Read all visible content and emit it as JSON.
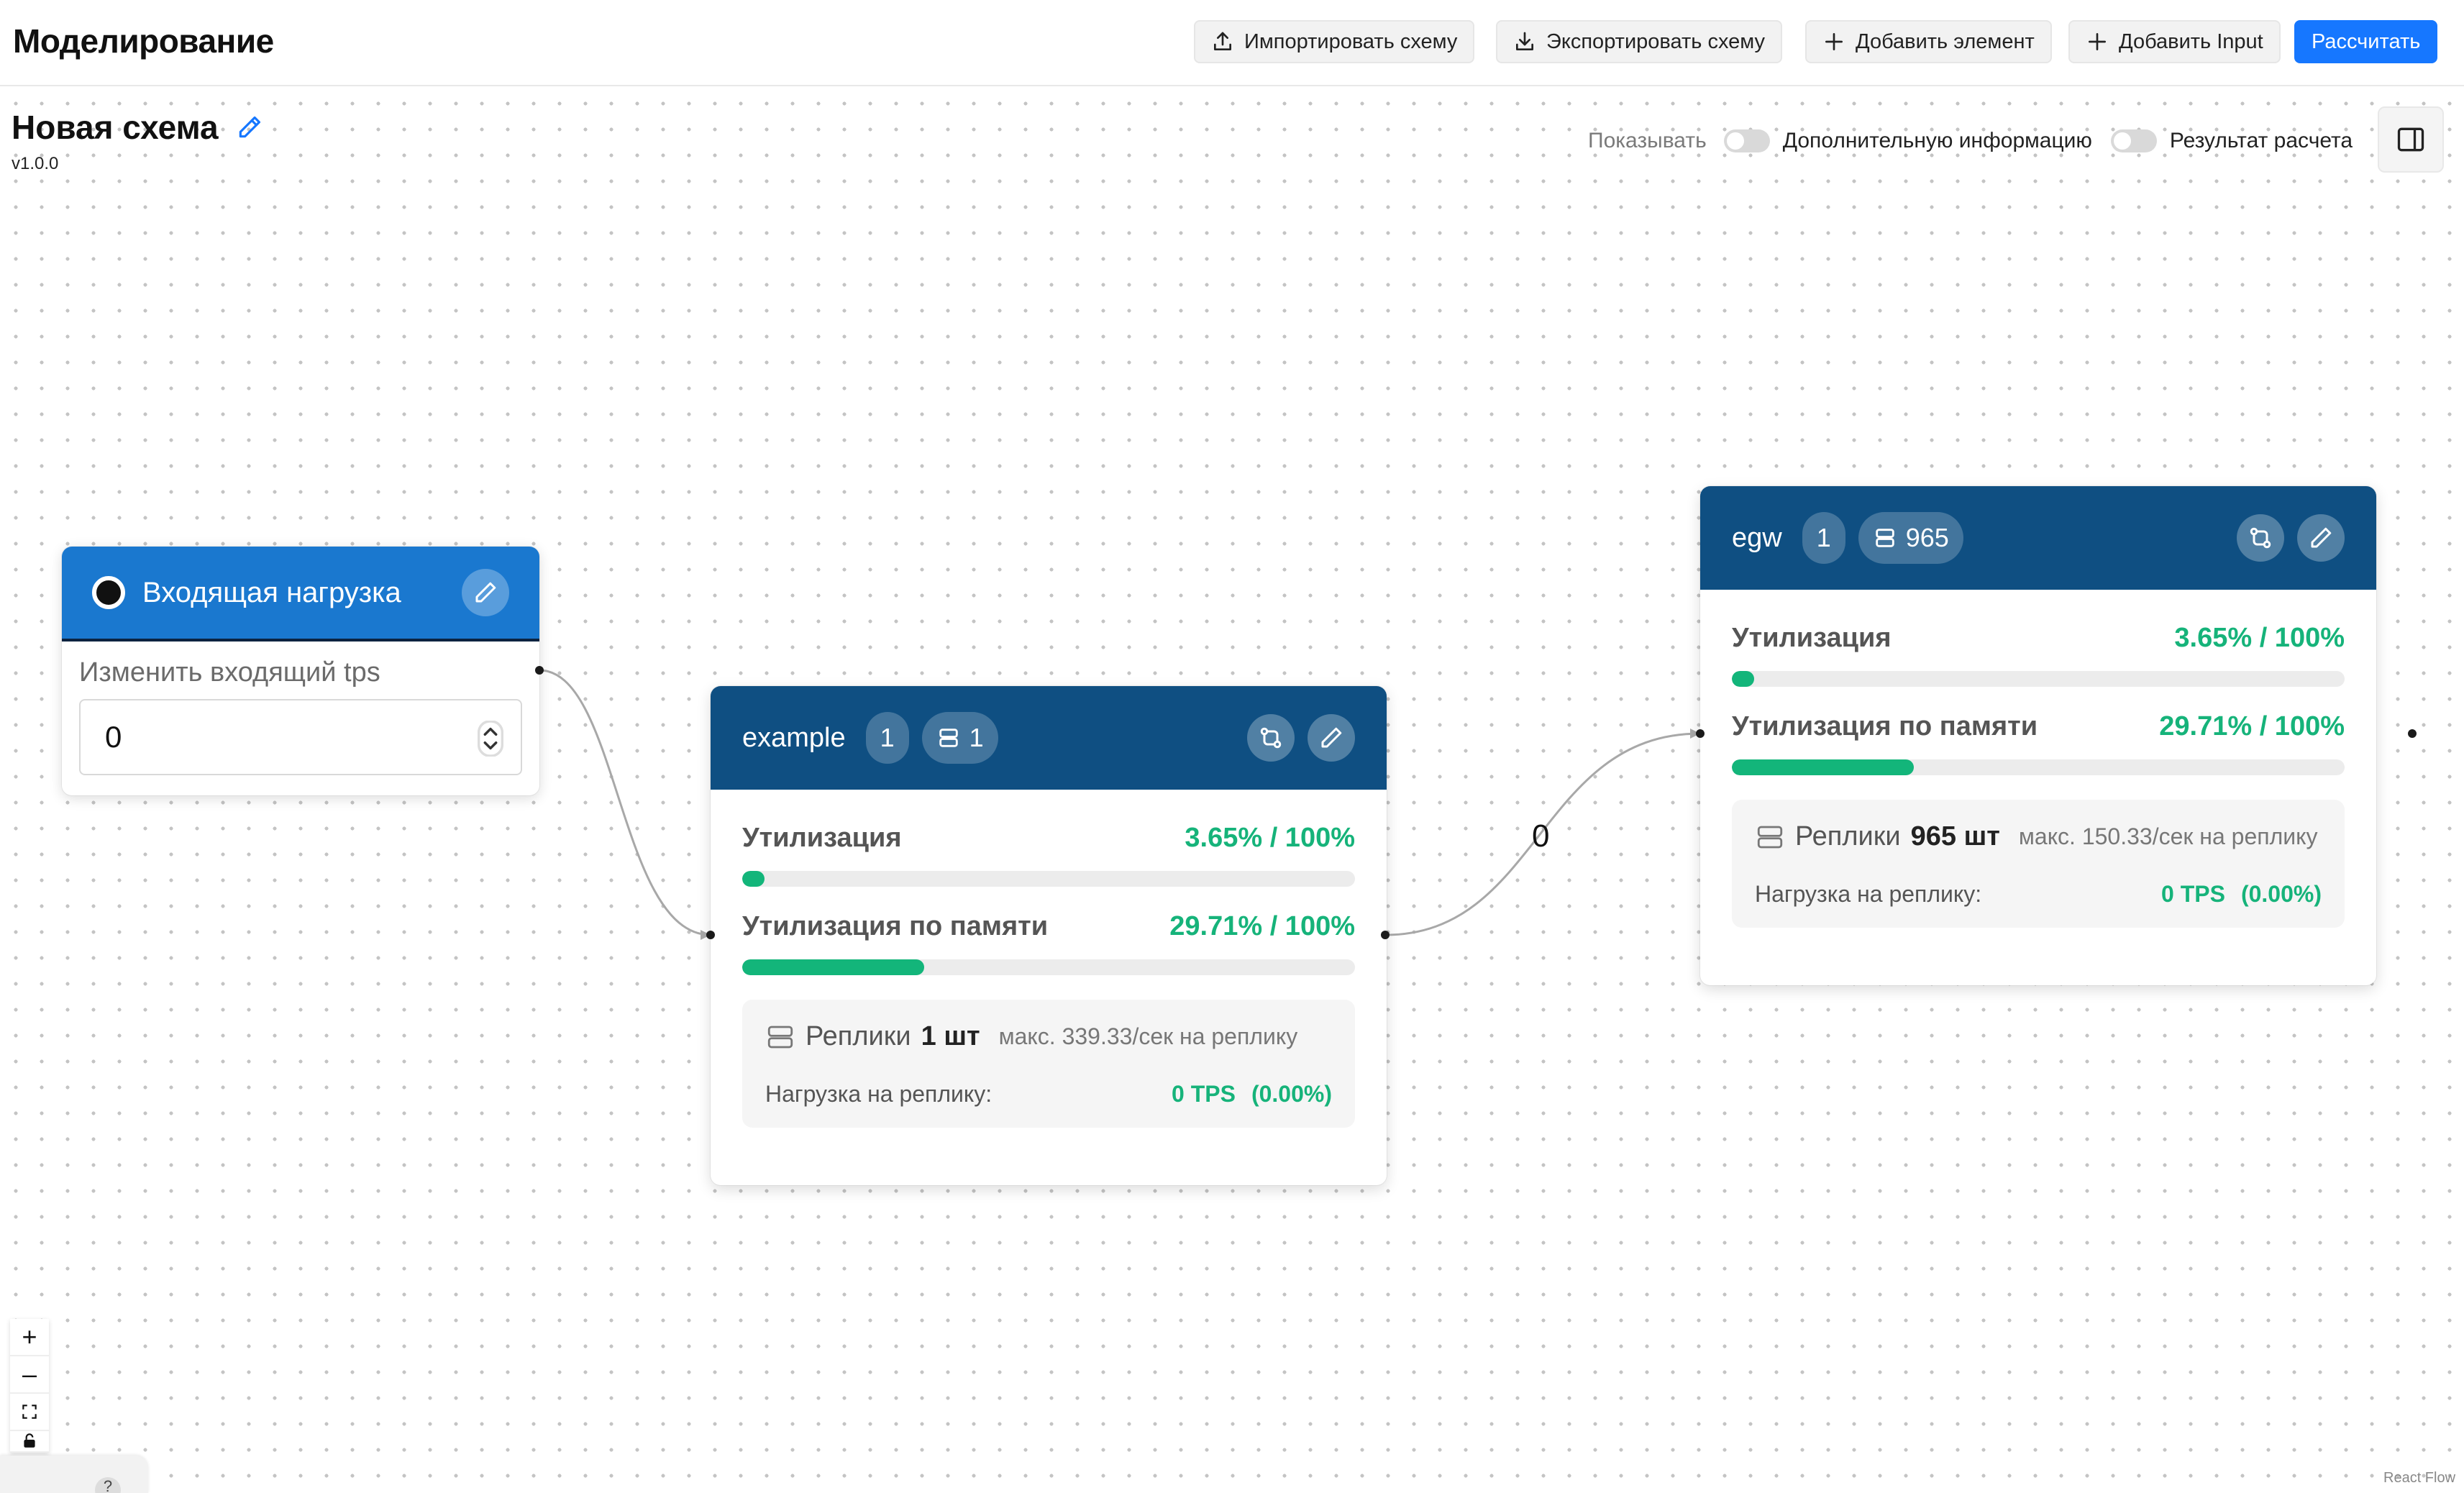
{
  "header": {
    "title": "Моделирование",
    "buttons": {
      "import": "Импортировать схему",
      "export": "Экспортировать схему",
      "add_element": "Добавить элемент",
      "add_input": "Добавить Input",
      "calculate": "Рассчитать"
    }
  },
  "scheme": {
    "title": "Новая схема",
    "version": "v1.0.0"
  },
  "display": {
    "show_label": "Показывать",
    "extra_info_label": "Дополнительную информацию",
    "extra_info_on": false,
    "calc_result_label": "Результат расчета",
    "calc_result_on": false
  },
  "input_node": {
    "title": "Входящая нагрузка",
    "caption": "Изменить входящий tps",
    "value": "0"
  },
  "edge_label": "0",
  "nodes": [
    {
      "name": "example",
      "instances": "1",
      "replicas_badge": "1",
      "util_label": "Утилизация",
      "util_value": "3.65% / 100%",
      "util_fraction": 0.0365,
      "mem_label": "Утилизация по памяти",
      "mem_value": "29.71% / 100%",
      "mem_fraction": 0.2971,
      "replicas_title": "Реплики",
      "replicas_count": "1 шт",
      "replicas_max": "макс. 339.33/сек на реплику",
      "load_label": "Нагрузка на реплику:",
      "load_tps": "0 TPS",
      "load_pct": "(0.00%)"
    },
    {
      "name": "egw",
      "instances": "1",
      "replicas_badge": "965",
      "util_label": "Утилизация",
      "util_value": "3.65% / 100%",
      "util_fraction": 0.0365,
      "mem_label": "Утилизация по памяти",
      "mem_value": "29.71% / 100%",
      "mem_fraction": 0.2971,
      "replicas_title": "Реплики",
      "replicas_count": "965 шт",
      "replicas_max": "макс. 150.33/сек на реплику",
      "load_label": "Нагрузка на реплику:",
      "load_tps": "0 TPS",
      "load_pct": "(0.00%)"
    }
  ],
  "zoom_controls": {
    "zoom_in": "+",
    "zoom_out": "–",
    "help": "?"
  },
  "attribution": "React Flow",
  "colors": {
    "primary": "#1677ff",
    "input_header": "#1a78cf",
    "node_header": "#0f4f82",
    "success": "#16b37a"
  }
}
